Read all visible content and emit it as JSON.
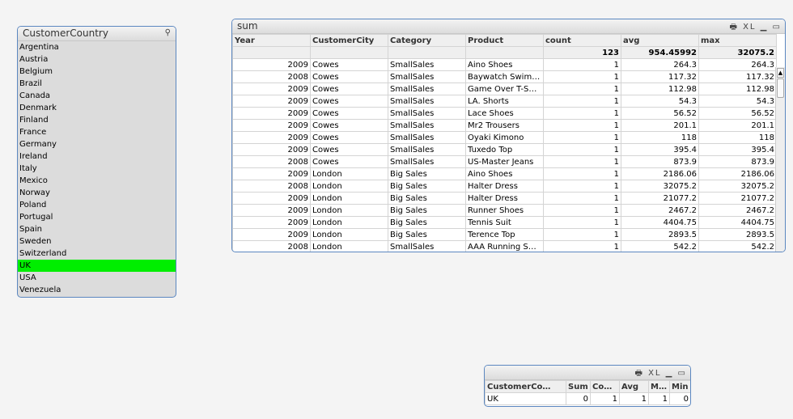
{
  "listbox": {
    "title": "CustomerCountry",
    "items": [
      "Argentina",
      "Austria",
      "Belgium",
      "Brazil",
      "Canada",
      "Denmark",
      "Finland",
      "France",
      "Germany",
      "Ireland",
      "Italy",
      "Mexico",
      "Norway",
      "Poland",
      "Portugal",
      "Spain",
      "Sweden",
      "Switzerland",
      "UK",
      "USA",
      "Venezuela"
    ],
    "selected": "UK",
    "selected_color": "#00ee00"
  },
  "table": {
    "title": "sum",
    "icons": "🖶 XL ▁ ▭",
    "columns": [
      "Year",
      "CustomerCity",
      "Category",
      "Product",
      "count",
      "avg",
      "max"
    ],
    "totals": [
      "",
      "",
      "",
      "",
      "123",
      "954.45992",
      "32075.2"
    ],
    "rows": [
      [
        "2009",
        "Cowes",
        "SmallSales",
        "Aino Shoes",
        "1",
        "264.3",
        "264.3"
      ],
      [
        "2008",
        "Cowes",
        "SmallSales",
        "Baywatch Swim…",
        "1",
        "117.32",
        "117.32"
      ],
      [
        "2009",
        "Cowes",
        "SmallSales",
        "Game Over T-Shirt",
        "1",
        "112.98",
        "112.98"
      ],
      [
        "2009",
        "Cowes",
        "SmallSales",
        "LA. Shorts",
        "1",
        "54.3",
        "54.3"
      ],
      [
        "2009",
        "Cowes",
        "SmallSales",
        "Lace Shoes",
        "1",
        "56.52",
        "56.52"
      ],
      [
        "2009",
        "Cowes",
        "SmallSales",
        "Mr2 Trousers",
        "1",
        "201.1",
        "201.1"
      ],
      [
        "2009",
        "Cowes",
        "SmallSales",
        "Oyaki Kimono",
        "1",
        "118",
        "118"
      ],
      [
        "2009",
        "Cowes",
        "SmallSales",
        "Tuxedo Top",
        "1",
        "395.4",
        "395.4"
      ],
      [
        "2008",
        "Cowes",
        "SmallSales",
        "US-Master Jeans",
        "1",
        "873.9",
        "873.9"
      ],
      [
        "2009",
        "London",
        "Big Sales",
        "Aino Shoes",
        "1",
        "2186.06",
        "2186.06"
      ],
      [
        "2008",
        "London",
        "Big Sales",
        "Halter Dress",
        "1",
        "32075.2",
        "32075.2"
      ],
      [
        "2009",
        "London",
        "Big Sales",
        "Halter Dress",
        "1",
        "21077.2",
        "21077.2"
      ],
      [
        "2009",
        "London",
        "Big Sales",
        "Runner Shoes",
        "1",
        "2467.2",
        "2467.2"
      ],
      [
        "2009",
        "London",
        "Big Sales",
        "Tennis Suit",
        "1",
        "4404.75",
        "4404.75"
      ],
      [
        "2009",
        "London",
        "Big Sales",
        "Terence Top",
        "1",
        "2893.5",
        "2893.5"
      ],
      [
        "2008",
        "London",
        "SmallSales",
        "AAA Running Shoe",
        "1",
        "542.2",
        "542.2"
      ]
    ]
  },
  "small_table": {
    "icons": "🖶 XL ▁ ▭",
    "columns": [
      "CustomerCo…",
      "Sum",
      "Count",
      "Avg",
      "Max",
      "Min"
    ],
    "row": [
      "UK",
      "0",
      "1",
      "1",
      "1",
      "0"
    ]
  }
}
